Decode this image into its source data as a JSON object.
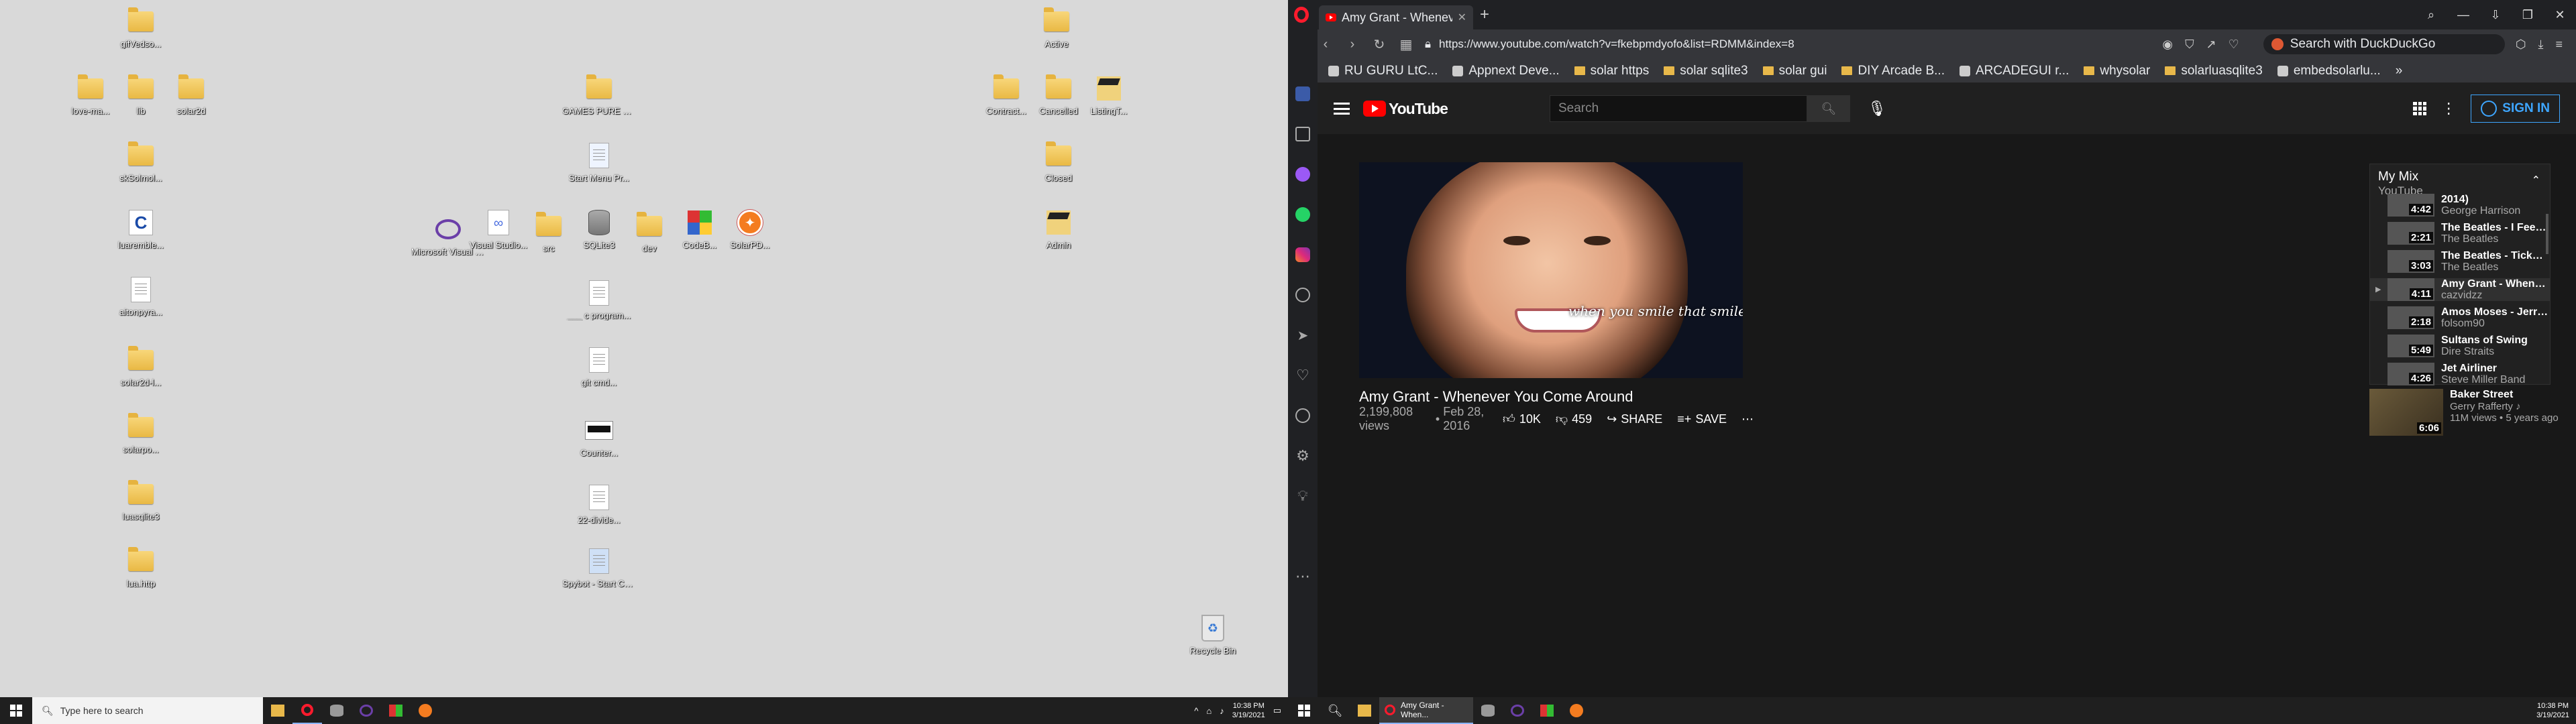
{
  "desktop": {
    "icons": [
      {
        "label": "gifVedso...",
        "kind": "folder"
      },
      {
        "label": "love-ma...",
        "kind": "folder"
      },
      {
        "label": "lib",
        "kind": "folder"
      },
      {
        "label": "solar2d",
        "kind": "folder"
      },
      {
        "label": "skSolmol...",
        "kind": "folder"
      },
      {
        "label": "luaremble...",
        "kind": "c-file"
      },
      {
        "label": "aitonpyra...",
        "kind": "doc"
      },
      {
        "label": "solar2d-l...",
        "kind": "folder"
      },
      {
        "label": "solarpo...",
        "kind": "folder"
      },
      {
        "label": "luasqlite3",
        "kind": "folder"
      },
      {
        "label": "lua.http",
        "kind": "folder"
      },
      {
        "label": "Microsoft Visual S...",
        "kind": "vs"
      },
      {
        "label": "Visual Studio...",
        "kind": "vsdoc"
      },
      {
        "label": "src",
        "kind": "folder"
      },
      {
        "label": "SQLite3",
        "kind": "db"
      },
      {
        "label": "dev",
        "kind": "folder"
      },
      {
        "label": "CodeB...",
        "kind": "codeblocks"
      },
      {
        "label": "SolarPD...",
        "kind": "solar"
      },
      {
        "label": "GAMES PURE H...",
        "kind": "folder"
      },
      {
        "label": "Start Menu Pr...",
        "kind": "start"
      },
      {
        "label": "___ c program...",
        "kind": "doc"
      },
      {
        "label": "git cmd...",
        "kind": "doc"
      },
      {
        "label": "Counter...",
        "kind": "bw"
      },
      {
        "label": "22-divide...",
        "kind": "doc"
      },
      {
        "label": "Spybot - Start Ce...",
        "kind": "spybot"
      },
      {
        "label": "Active",
        "kind": "folder"
      },
      {
        "label": "Contract...",
        "kind": "folder"
      },
      {
        "label": "Cancelled",
        "kind": "folder"
      },
      {
        "label": "ListingT...",
        "kind": "grad"
      },
      {
        "label": "Closed",
        "kind": "folder"
      },
      {
        "label": "Admin",
        "kind": "grad"
      },
      {
        "label": "Recycle Bin",
        "kind": "recycle"
      }
    ]
  },
  "left_taskbar": {
    "search_placeholder": "Type here to search",
    "clock_time": "10:38 PM",
    "clock_date": "3/19/2021"
  },
  "browser": {
    "tab_title": "Amy Grant - Whenever",
    "url": "https://www.youtube.com/watch?v=fkebpmdyofo&list=RDMM&index=8",
    "search_engine_placeholder": "Search with DuckDuckGo",
    "bookmarks": [
      {
        "label": "RU GURU LtC...",
        "kind": "icon"
      },
      {
        "label": "Appnext Deve...",
        "kind": "icon"
      },
      {
        "label": "solar https",
        "kind": "folder"
      },
      {
        "label": "solar sqlite3",
        "kind": "folder"
      },
      {
        "label": "solar gui",
        "kind": "folder"
      },
      {
        "label": "DIY Arcade B...",
        "kind": "folder"
      },
      {
        "label": "ARCADEGUI r...",
        "kind": "icon"
      },
      {
        "label": "whysolar",
        "kind": "folder"
      },
      {
        "label": "solarluasqlite3",
        "kind": "folder"
      },
      {
        "label": "embedsolarlu...",
        "kind": "icon"
      }
    ]
  },
  "youtube": {
    "logo_text": "YouTube",
    "search_placeholder": "Search",
    "sign_in": "SIGN IN",
    "caption": "when you smile that smile",
    "video_title": "Amy Grant - Whenever You Come Around",
    "views": "2,199,808 views",
    "date": "Feb 28, 2016",
    "likes": "10K",
    "dislikes": "459",
    "share": "SHARE",
    "save": "SAVE",
    "playlist": {
      "title": "My Mix",
      "subtitle": "YouTube",
      "items": [
        {
          "title": "2014)",
          "channel": "George Harrison",
          "duration": "4:42",
          "active": false
        },
        {
          "title": "The Beatles - I Feel Fine",
          "channel": "The Beatles",
          "duration": "2:21",
          "active": false
        },
        {
          "title": "The Beatles - Ticket To Ride",
          "channel": "The Beatles",
          "duration": "3:03",
          "active": false
        },
        {
          "title": "Amy Grant - Whenever You Come Around",
          "channel": "cazvidzz",
          "duration": "4:11",
          "active": true
        },
        {
          "title": "Amos Moses - Jerry Reed",
          "channel": "folsom90",
          "duration": "2:18",
          "active": false
        },
        {
          "title": "Sultans of Swing",
          "channel": "Dire Straits",
          "duration": "5:49",
          "active": false
        },
        {
          "title": "Jet Airliner",
          "channel": "Steve Miller Band",
          "duration": "4:26",
          "active": false
        }
      ]
    },
    "recommendation": {
      "title": "Baker Street",
      "channel": "Gerry Rafferty ♪",
      "meta": "11M views • 5 years ago",
      "duration": "6:06"
    }
  },
  "right_taskbar": {
    "browser_tab": "Amy Grant - When...",
    "clock_time": "10:38 PM",
    "clock_date": "3/19/2021"
  }
}
